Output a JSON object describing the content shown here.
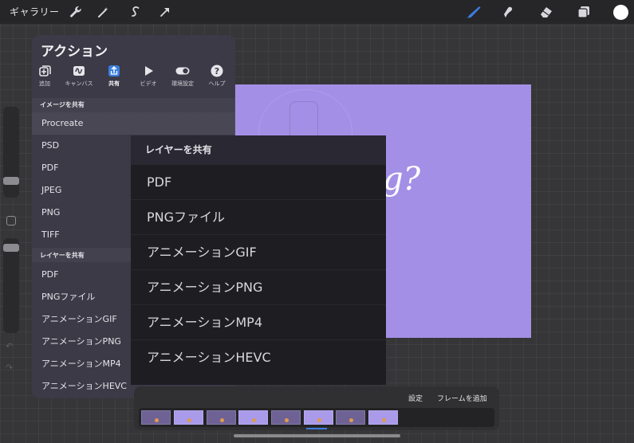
{
  "topbar": {
    "gallery_label": "ギャラリー",
    "left_tools": [
      {
        "icon": "wrench-icon"
      },
      {
        "icon": "magic-wand-icon"
      },
      {
        "icon": "selection-s-icon"
      },
      {
        "icon": "transform-arrow-icon"
      }
    ],
    "right_tools": [
      {
        "icon": "brush-icon"
      },
      {
        "icon": "smudge-icon"
      },
      {
        "icon": "eraser-icon"
      },
      {
        "icon": "layers-icon"
      }
    ],
    "active_color": "#ffffff",
    "brush_color": "#3b7de0"
  },
  "canvas": {
    "background": "#a48fe6",
    "visible_text": "g?"
  },
  "actions_panel": {
    "title": "アクション",
    "tabs": [
      {
        "label": "追加",
        "icon": "add-icon"
      },
      {
        "label": "キャンバス",
        "icon": "canvas-icon"
      },
      {
        "label": "共有",
        "icon": "share-icon",
        "active": true
      },
      {
        "label": "ビデオ",
        "icon": "play-icon"
      },
      {
        "label": "環境設定",
        "icon": "toggle-icon"
      },
      {
        "label": "ヘルプ",
        "icon": "help-icon"
      }
    ],
    "share_image": {
      "header": "イメージを共有",
      "items": [
        "Procreate",
        "PSD",
        "PDF",
        "JPEG",
        "PNG",
        "TIFF"
      ]
    },
    "share_layers": {
      "header": "レイヤーを共有",
      "items": [
        "PDF",
        "PNGファイル",
        "アニメーションGIF",
        "アニメーションPNG",
        "アニメーションMP4",
        "アニメーションHEVC"
      ]
    }
  },
  "share_popup": {
    "header": "レイヤーを共有",
    "items": [
      "PDF",
      "PNGファイル",
      "アニメーションGIF",
      "アニメーションPNG",
      "アニメーションMP4",
      "アニメーションHEVC"
    ]
  },
  "timeline": {
    "settings_label": "設定",
    "add_frame_label": "フレームを追加",
    "frame_count": 8,
    "selected_frame": 6
  }
}
